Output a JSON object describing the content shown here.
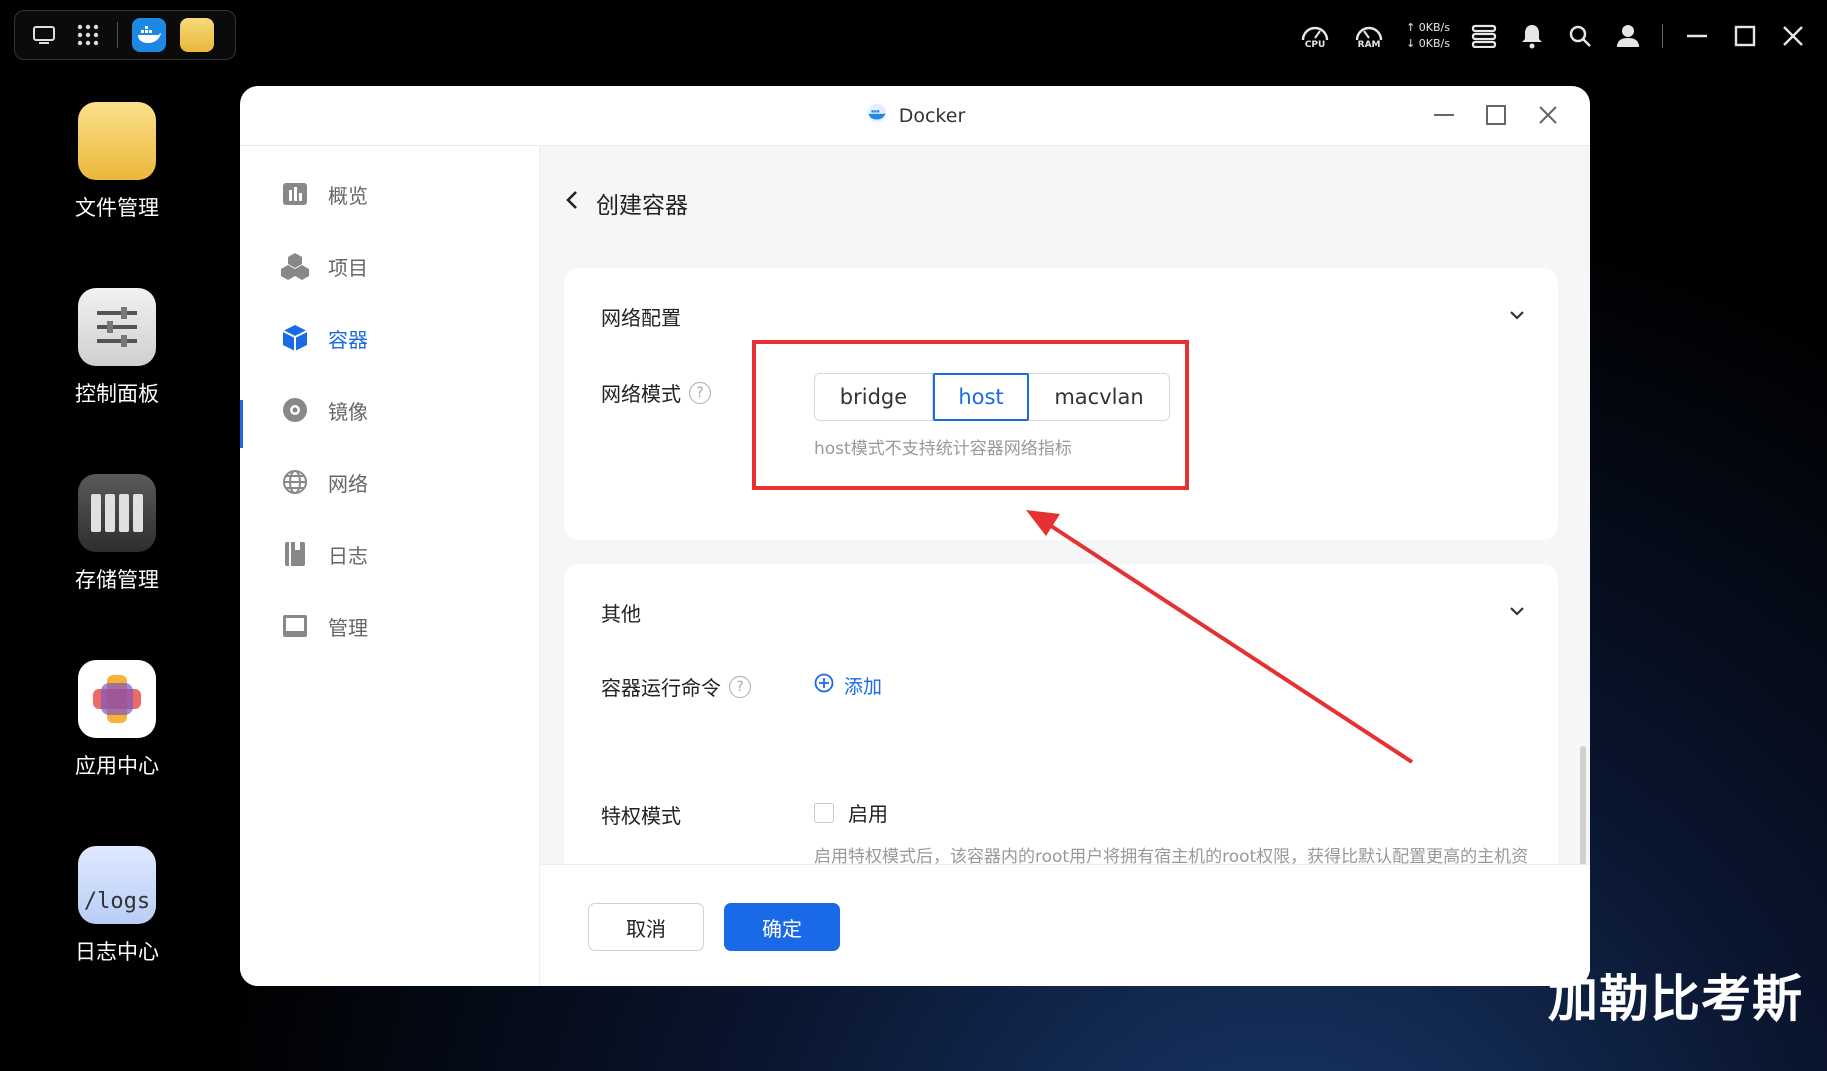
{
  "taskbar": {
    "cpu_label": "CPU",
    "ram_label": "RAM",
    "upload_speed": "0KB/s",
    "download_speed": "0KB/s"
  },
  "desktop": {
    "icons": [
      {
        "label": "文件管理"
      },
      {
        "label": "控制面板"
      },
      {
        "label": "存储管理"
      },
      {
        "label": "应用中心"
      },
      {
        "label": "日志中心",
        "badge": "/logs"
      }
    ]
  },
  "window": {
    "title": "Docker"
  },
  "sidebar": {
    "items": [
      {
        "label": "概览",
        "icon": "chart-icon"
      },
      {
        "label": "项目",
        "icon": "cubes-icon"
      },
      {
        "label": "容器",
        "icon": "cube-icon",
        "active": true
      },
      {
        "label": "镜像",
        "icon": "disc-icon"
      },
      {
        "label": "网络",
        "icon": "globe-icon"
      },
      {
        "label": "日志",
        "icon": "book-icon"
      },
      {
        "label": "管理",
        "icon": "window-icon"
      }
    ]
  },
  "page": {
    "title": "创建容器"
  },
  "network_card": {
    "title": "网络配置",
    "mode_label": "网络模式",
    "options": [
      "bridge",
      "host",
      "macvlan"
    ],
    "selected": "host",
    "hint": "host模式不支持统计容器网络指标"
  },
  "other_card": {
    "title": "其他",
    "command_label": "容器运行命令",
    "add_label": "添加",
    "privileged_label": "特权模式",
    "enable_label": "启用",
    "privileged_hint": "启用特权模式后，该容器内的root用户将拥有宿主机的root权限，获得比默认配置更高的主机资"
  },
  "footer": {
    "cancel": "取消",
    "confirm": "确定"
  },
  "watermark": "加勒比考斯",
  "colors": {
    "accent": "#1a6ae8",
    "annotation": "#e53131"
  }
}
